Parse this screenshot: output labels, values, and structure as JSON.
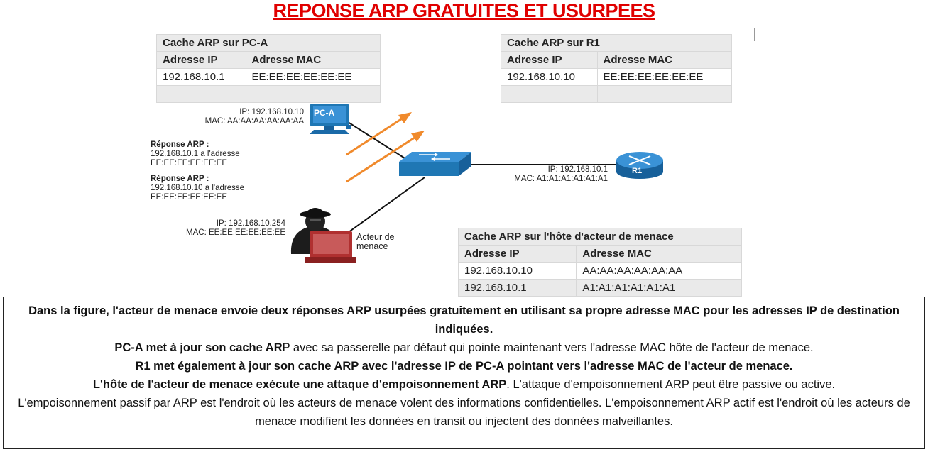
{
  "title": "REPONSE ARP GRATUITES ET USURPEES",
  "tables": {
    "pca": {
      "caption": "Cache ARP sur PC-A",
      "col_ip": "Adresse IP",
      "col_mac": "Adresse MAC",
      "rows": [
        {
          "ip": "192.168.10.1",
          "mac": "EE:EE:EE:EE:EE:EE"
        },
        {
          "ip": "",
          "mac": ""
        }
      ]
    },
    "r1": {
      "caption": "Cache ARP sur R1",
      "col_ip": "Adresse IP",
      "col_mac": "Adresse MAC",
      "rows": [
        {
          "ip": "192.168.10.10",
          "mac": "EE:EE:EE:EE:EE:EE"
        },
        {
          "ip": "",
          "mac": ""
        }
      ]
    },
    "attacker": {
      "caption": "Cache ARP sur l'hôte d'acteur de menace",
      "col_ip": "Adresse IP",
      "col_mac": "Adresse MAC",
      "rows": [
        {
          "ip": "192.168.10.10",
          "mac": "AA:AA:AA:AA:AA:AA"
        },
        {
          "ip": "192.168.10.1",
          "mac": "A1:A1:A1:A1:A1:A1"
        }
      ]
    }
  },
  "devices": {
    "pca": {
      "name": "PC-A",
      "ip": "IP: 192.168.10.10",
      "mac": "MAC: AA:AA:AA:AA:AA:AA"
    },
    "r1": {
      "name": "R1",
      "ip": "IP: 192.168.10.1",
      "mac": "MAC: A1:A1:A1:A1:A1:A1"
    },
    "attacker": {
      "label_line1": "Acteur de",
      "label_line2": "menace",
      "ip": "IP: 192.168.10.254",
      "mac": "MAC: EE:EE:EE:EE:EE:EE"
    }
  },
  "arp_replies": [
    {
      "heading": "Réponse ARP :",
      "line1": "192.168.10.1 a l'adresse",
      "line2": "EE:EE:EE:EE:EE:EE"
    },
    {
      "heading": "Réponse ARP :",
      "line1": "192.168.10.10 a l'adresse",
      "line2": "EE:EE:EE:EE:EE:EE"
    }
  ],
  "colors": {
    "title": "#e00000",
    "arrow": "#f08a2c",
    "device_blue": "#1f77b4",
    "attacker_red": "#b03030"
  },
  "text": {
    "p1": "Dans la figure, l'acteur de menace envoie deux réponses ARP usurpées gratuitement en utilisant sa propre adresse MAC pour les adresses IP de destination indiquées.",
    "p2_bold": "PC-A met à jour son cache AR",
    "p2_rest": "P avec sa passerelle par défaut qui pointe maintenant vers l'adresse MAC hôte de l'acteur de menace.",
    "p3": "R1 met également à jour son cache ARP avec l'adresse IP de PC-A pointant vers l'adresse MAC de l'acteur de menace.",
    "p4_bold": "L'hôte de l'acteur de menace exécute une attaque d'empoisonnement ARP",
    "p4_rest": ". L'attaque d'empoisonnement ARP peut être passive ou active.",
    "p5": "L'empoisonnement passif par ARP est l'endroit où les acteurs de menace volent des informations confidentielles. L'empoisonnement ARP actif est l'endroit où les acteurs de menace modifient les données en transit ou injectent des données malveillantes."
  }
}
